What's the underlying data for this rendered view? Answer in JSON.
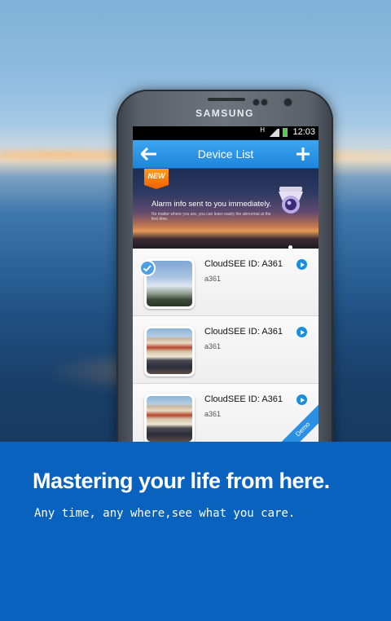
{
  "phone": {
    "brand": "SAMSUNG",
    "status_time": "12:03",
    "status_network": "H"
  },
  "app": {
    "title": "Device List"
  },
  "banner": {
    "tag": "NEW",
    "headline": "Alarm info sent to you immediately.",
    "subtext": "No matter where you are, you can learn easily the abnormal at the first time."
  },
  "devices": [
    {
      "name": "CloudSEE ID: A361",
      "sub": "a361"
    },
    {
      "name": "CloudSEE ID: A361",
      "sub": "a361"
    },
    {
      "name": "CloudSEE ID: A361",
      "sub": "a361"
    }
  ],
  "demo_label": "Demo",
  "promo": {
    "headline": "Mastering your life from here.",
    "tagline": "Any time, any where,see what you care."
  },
  "colors": {
    "accent": "#1d86dc",
    "panel": "#0a62bf"
  }
}
